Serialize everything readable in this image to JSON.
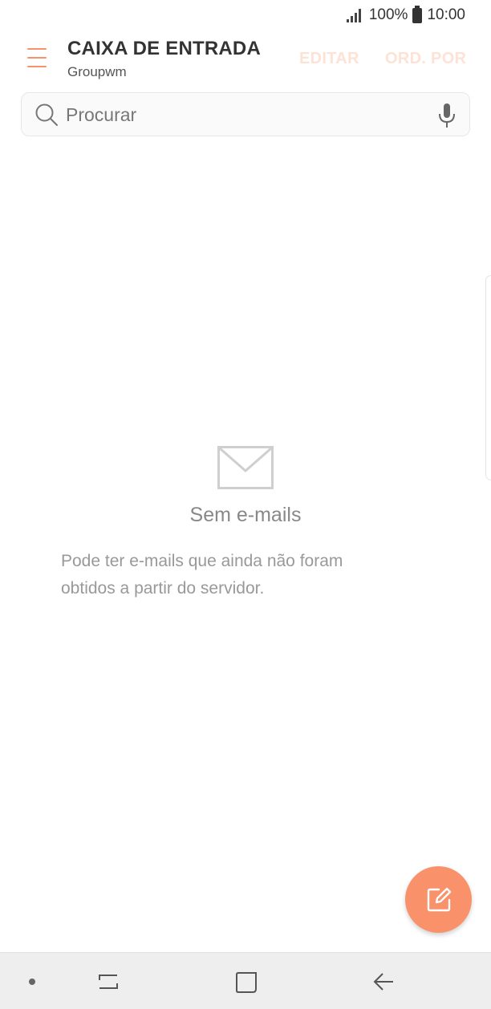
{
  "status_bar": {
    "battery": "100%",
    "time": "10:00",
    "icons": [
      "signal-icon",
      "battery-icon"
    ]
  },
  "header": {
    "title": "CAIXA DE ENTRADA",
    "account": "Groupwm",
    "edit_label": "EDITAR",
    "sort_label": "ORD. POR"
  },
  "search": {
    "placeholder": "Procurar",
    "value": ""
  },
  "empty_state": {
    "title": "Sem e-mails",
    "message": "Pode ter e-mails que ainda não foram obtidos a partir do servidor."
  },
  "colors": {
    "accent": "#f9926b",
    "accent_light": "#fde2d6",
    "text_dark": "#333333",
    "text_muted": "#999999"
  }
}
